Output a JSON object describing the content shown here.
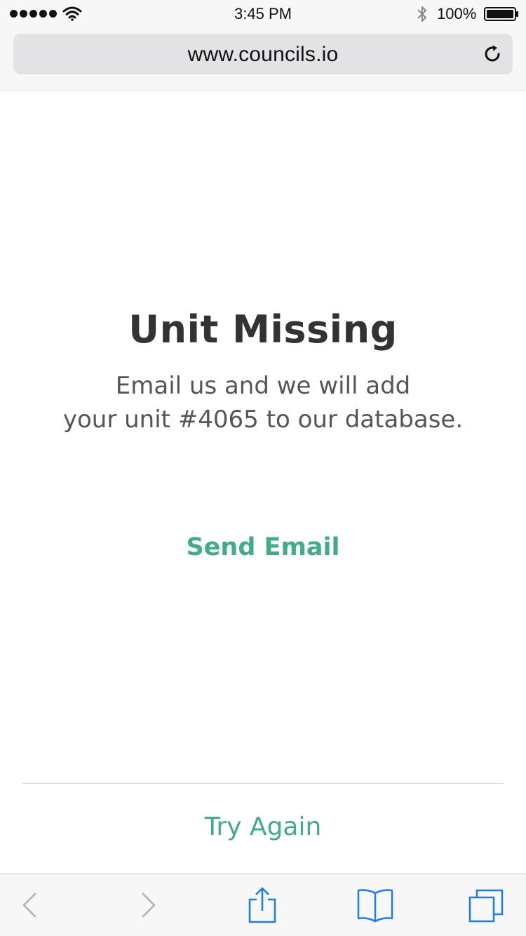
{
  "status_bar": {
    "time": "3:45 PM",
    "battery_percent": "100%",
    "signal_bars": 5,
    "icons": [
      "signal-dots",
      "wifi-icon",
      "bluetooth-icon",
      "battery-icon"
    ]
  },
  "browser": {
    "url": "www.councils.io",
    "reload_icon": "reload-icon"
  },
  "content": {
    "title": "Unit Missing",
    "message_line1": "Email us and we will add",
    "message_line2": "your unit #4065 to our database.",
    "send_email_label": "Send Email",
    "try_again_label": "Try Again"
  },
  "toolbar": {
    "icons": [
      "back-icon",
      "forward-icon",
      "share-icon",
      "bookmarks-icon",
      "tabs-icon"
    ]
  },
  "colors": {
    "accent": "#3fad8a",
    "ios_blue": "#1a7cf4",
    "disabled": "#b8b8bd",
    "title": "#333333",
    "body_text": "#555555"
  }
}
